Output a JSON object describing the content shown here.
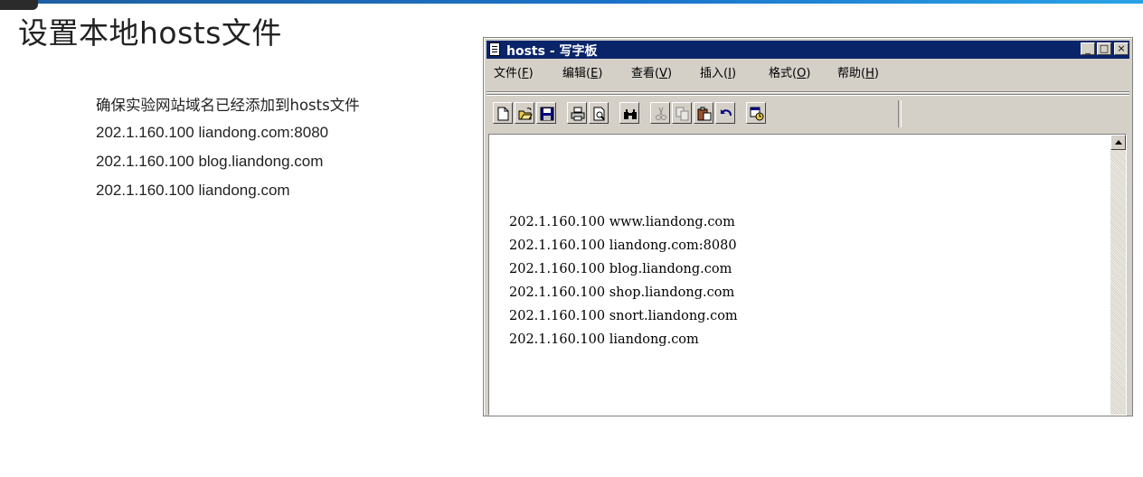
{
  "slide": {
    "title": "设置本地hosts文件",
    "intro": "确保实验网站域名已经添加到hosts文件",
    "lines": [
      "202.1.160.100 liandong.com:8080",
      "202.1.160.100 blog.liandong.com",
      "202.1.160.100 liandong.com"
    ]
  },
  "window": {
    "title": "hosts - 写字板",
    "buttons": {
      "minimize": "_",
      "maximize": "□",
      "close": "×"
    }
  },
  "menu": [
    {
      "label": "文件",
      "key": "F"
    },
    {
      "label": "编辑",
      "key": "E"
    },
    {
      "label": "查看",
      "key": "V"
    },
    {
      "label": "插入",
      "key": "I"
    },
    {
      "label": "格式",
      "key": "O"
    },
    {
      "label": "帮助",
      "key": "H"
    }
  ],
  "toolbar": [
    "new-icon",
    "open-icon",
    "save-icon",
    "print-icon",
    "print-preview-icon",
    "find-icon",
    "cut-icon",
    "copy-icon",
    "paste-icon",
    "undo-icon",
    "date-time-icon"
  ],
  "document": {
    "lines": [
      "202.1.160.100 www.liandong.com",
      "202.1.160.100 liandong.com:8080",
      "202.1.160.100 blog.liandong.com",
      "202.1.160.100 shop.liandong.com",
      "202.1.160.100 snort.liandong.com",
      "202.1.160.100 liandong.com"
    ]
  },
  "colors": {
    "titlebar": "#0a246a",
    "face": "#d4d0c8",
    "accent": "#1a73c9"
  }
}
